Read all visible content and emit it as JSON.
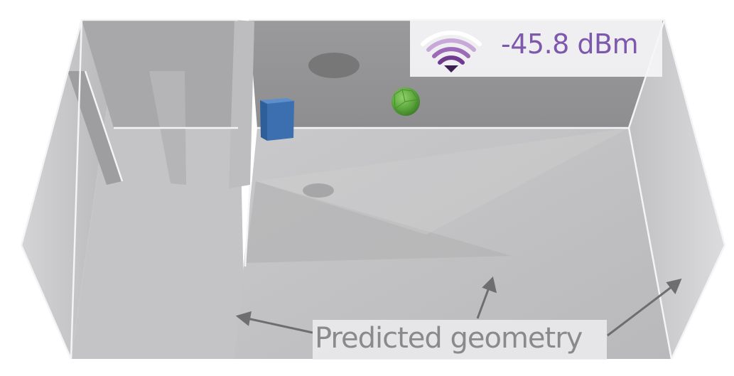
{
  "signal": {
    "icon": "wifi-signal-icon",
    "value": "-45.8 dBm",
    "color": "#7d58ad"
  },
  "annotation": {
    "label": "Predicted geometry",
    "color": "#8a8a8a"
  },
  "scene": {
    "transmitter": {
      "shape": "cube",
      "color": "#3b6fb0"
    },
    "receiver": {
      "shape": "sphere",
      "color": "#5aa63b"
    }
  }
}
